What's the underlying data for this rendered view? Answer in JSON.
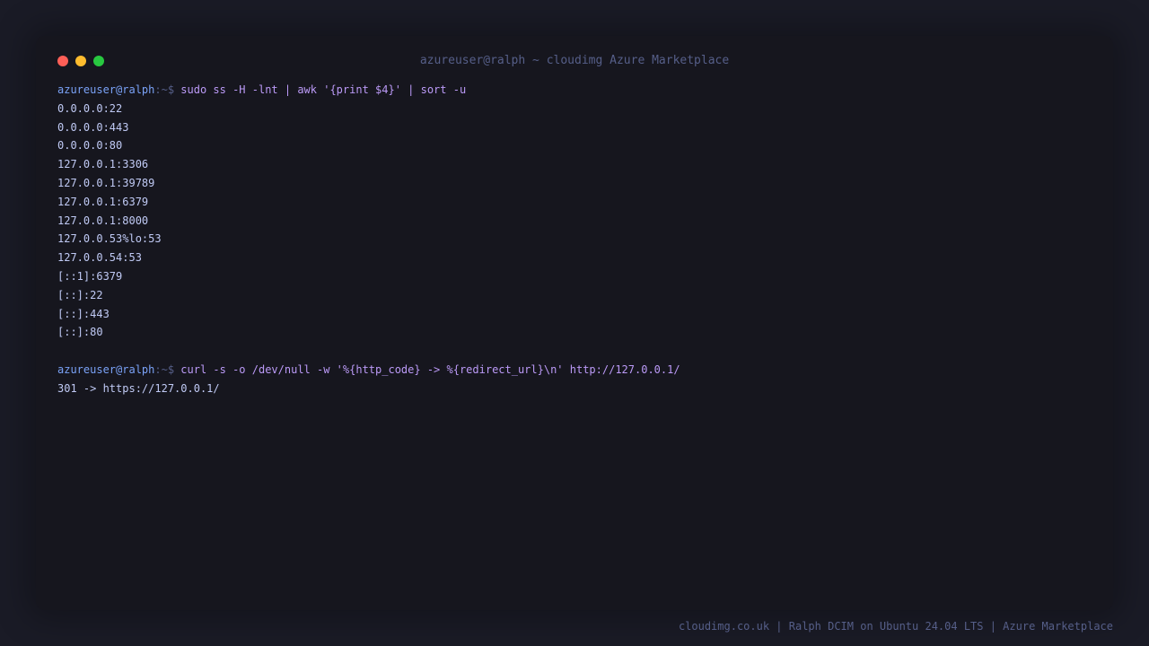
{
  "window": {
    "title": "azureuser@ralph ~ cloudimg Azure Marketplace"
  },
  "blocks": [
    {
      "prompt_user": "azureuser@ralph",
      "prompt_sep": ":~$ ",
      "command": "sudo ss -H -lnt | awk '{print $4}' | sort -u",
      "output": [
        "0.0.0.0:22",
        "0.0.0.0:443",
        "0.0.0.0:80",
        "127.0.0.1:3306",
        "127.0.0.1:39789",
        "127.0.0.1:6379",
        "127.0.0.1:8000",
        "127.0.0.53%lo:53",
        "127.0.0.54:53",
        "[::1]:6379",
        "[::]:22",
        "[::]:443",
        "[::]:80"
      ]
    },
    {
      "prompt_user": "azureuser@ralph",
      "prompt_sep": ":~$ ",
      "command": "curl -s -o /dev/null -w '%{http_code} -> %{redirect_url}\\n' http://127.0.0.1/",
      "output": [
        "301 -> https://127.0.0.1/"
      ]
    }
  ],
  "footer": {
    "text": "cloudimg.co.uk | Ralph DCIM on Ubuntu 24.04 LTS | Azure Marketplace"
  },
  "colors": {
    "background": "#1a1b26",
    "window": "#16161e",
    "prompt": "#7aa2f7",
    "command": "#bb9af7",
    "output": "#c0caf5",
    "muted": "#565f89",
    "close": "#ff5f57",
    "minimize": "#febc2e",
    "maximize": "#28c840"
  }
}
